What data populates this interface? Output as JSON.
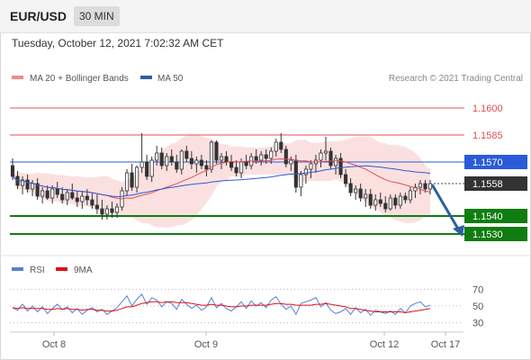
{
  "header": {
    "symbol": "EUR/USD",
    "timeframe": "30 MIN"
  },
  "datetime": "Tuesday, October 12, 2021 7:02:32 AM CET",
  "legend": {
    "ma20": {
      "label": "MA 20 + Bollinger Bands",
      "color": "#f08a8a"
    },
    "ma50": {
      "label": "MA 50",
      "color": "#2d5fa0"
    }
  },
  "credit": "Research © 2021 Trading Central",
  "rsi_legend": {
    "rsi": {
      "label": "RSI",
      "color": "#5b7fd6"
    },
    "ma9": {
      "label": "9MA",
      "color": "#e01010"
    }
  },
  "colors": {
    "resistance": "#e05050",
    "pivot": "#2a5bd7",
    "support": "#0f7d0f",
    "last": "#333333",
    "arrow": "#2d5fa0"
  },
  "chart_data": [
    {
      "type": "candlestick",
      "ylim": [
        1.1518,
        1.1612
      ],
      "x_ticks": [
        "Oct 8",
        "Oct 9",
        "Oct 12",
        "Oct 17"
      ],
      "levels": [
        {
          "value": 1.16,
          "label": "1.1600",
          "kind": "resistance"
        },
        {
          "value": 1.1585,
          "label": "1.1585",
          "kind": "resistance"
        },
        {
          "value": 1.157,
          "label": "1.1570",
          "kind": "pivot"
        },
        {
          "value": 1.154,
          "label": "1.1540",
          "kind": "support"
        },
        {
          "value": 1.153,
          "label": "1.1530",
          "kind": "support"
        }
      ],
      "last_price": {
        "value": 1.1558,
        "label": "1.1558"
      },
      "candles_ohlc": [
        [
          1.1568,
          1.1572,
          1.156,
          1.1562
        ],
        [
          1.1562,
          1.1565,
          1.1555,
          1.1557
        ],
        [
          1.1557,
          1.1562,
          1.1552,
          1.156
        ],
        [
          1.156,
          1.1563,
          1.1553,
          1.1555
        ],
        [
          1.1555,
          1.156,
          1.1551,
          1.1558
        ],
        [
          1.1558,
          1.1561,
          1.1549,
          1.1551
        ],
        [
          1.1551,
          1.1556,
          1.1547,
          1.1554
        ],
        [
          1.1554,
          1.1557,
          1.1549,
          1.155
        ],
        [
          1.155,
          1.1557,
          1.1547,
          1.1555
        ],
        [
          1.1555,
          1.1559,
          1.155,
          1.1552
        ],
        [
          1.1552,
          1.1556,
          1.1547,
          1.1549
        ],
        [
          1.1549,
          1.1555,
          1.1546,
          1.1553
        ],
        [
          1.1553,
          1.1558,
          1.1549,
          1.155
        ],
        [
          1.155,
          1.1554,
          1.1545,
          1.1548
        ],
        [
          1.1548,
          1.1554,
          1.1544,
          1.1551
        ],
        [
          1.1551,
          1.1555,
          1.1546,
          1.1549
        ],
        [
          1.1549,
          1.1553,
          1.1544,
          1.1546
        ],
        [
          1.1546,
          1.1552,
          1.1541,
          1.1544
        ],
        [
          1.1544,
          1.1549,
          1.1538,
          1.1541
        ],
        [
          1.1541,
          1.1546,
          1.1538,
          1.1544
        ],
        [
          1.1544,
          1.1548,
          1.1539,
          1.1542
        ],
        [
          1.1542,
          1.1547,
          1.1539,
          1.1545
        ],
        [
          1.1545,
          1.1556,
          1.1543,
          1.1554
        ],
        [
          1.1554,
          1.1566,
          1.1551,
          1.1564
        ],
        [
          1.1564,
          1.1569,
          1.1554,
          1.1556
        ],
        [
          1.1556,
          1.1568,
          1.1553,
          1.1567
        ],
        [
          1.1567,
          1.1586,
          1.1564,
          1.157
        ],
        [
          1.157,
          1.1574,
          1.156,
          1.1562
        ],
        [
          1.1562,
          1.1573,
          1.1559,
          1.1571
        ],
        [
          1.1571,
          1.1579,
          1.1568,
          1.1575
        ],
        [
          1.1575,
          1.1578,
          1.1566,
          1.1568
        ],
        [
          1.1568,
          1.1575,
          1.1565,
          1.1573
        ],
        [
          1.1573,
          1.1577,
          1.1568,
          1.157
        ],
        [
          1.157,
          1.1574,
          1.1564,
          1.1566
        ],
        [
          1.1566,
          1.1577,
          1.1563,
          1.1576
        ],
        [
          1.1576,
          1.1579,
          1.157,
          1.1572
        ],
        [
          1.1572,
          1.1576,
          1.1566,
          1.1569
        ],
        [
          1.1569,
          1.1573,
          1.1564,
          1.1571
        ],
        [
          1.1571,
          1.1574,
          1.1566,
          1.1568
        ],
        [
          1.1568,
          1.1571,
          1.1562,
          1.1566
        ],
        [
          1.1566,
          1.1582,
          1.1564,
          1.1581
        ],
        [
          1.1581,
          1.1582,
          1.1569,
          1.1571
        ],
        [
          1.1571,
          1.1575,
          1.1566,
          1.1573
        ],
        [
          1.1573,
          1.1576,
          1.1568,
          1.157
        ],
        [
          1.157,
          1.1574,
          1.1565,
          1.1567
        ],
        [
          1.1567,
          1.1571,
          1.1562,
          1.1564
        ],
        [
          1.1564,
          1.1572,
          1.1561,
          1.157
        ],
        [
          1.157,
          1.1574,
          1.1566,
          1.1568
        ],
        [
          1.1568,
          1.1575,
          1.1566,
          1.1573
        ],
        [
          1.1573,
          1.1577,
          1.1569,
          1.1571
        ],
        [
          1.1571,
          1.1576,
          1.1568,
          1.1574
        ],
        [
          1.1574,
          1.1577,
          1.1569,
          1.1572
        ],
        [
          1.1572,
          1.1578,
          1.1569,
          1.1576
        ],
        [
          1.1576,
          1.1583,
          1.1573,
          1.1581
        ],
        [
          1.1581,
          1.1586,
          1.1575,
          1.1577
        ],
        [
          1.1577,
          1.1579,
          1.1567,
          1.1569
        ],
        [
          1.1569,
          1.1573,
          1.1565,
          1.1571
        ],
        [
          1.1571,
          1.1574,
          1.1553,
          1.1556
        ],
        [
          1.1556,
          1.1565,
          1.1551,
          1.1563
        ],
        [
          1.1563,
          1.1568,
          1.1558,
          1.1566
        ],
        [
          1.1566,
          1.1571,
          1.1561,
          1.1569
        ],
        [
          1.1569,
          1.1574,
          1.1564,
          1.1571
        ],
        [
          1.1571,
          1.1577,
          1.1567,
          1.1575
        ],
        [
          1.1575,
          1.1584,
          1.1571,
          1.1576
        ],
        [
          1.1576,
          1.1578,
          1.1566,
          1.1568
        ],
        [
          1.1568,
          1.1574,
          1.1563,
          1.1572
        ],
        [
          1.1572,
          1.1575,
          1.1561,
          1.1563
        ],
        [
          1.1563,
          1.1566,
          1.1556,
          1.1558
        ],
        [
          1.1558,
          1.1561,
          1.1551,
          1.1553
        ],
        [
          1.1553,
          1.1557,
          1.1549,
          1.1555
        ],
        [
          1.1555,
          1.1558,
          1.1548,
          1.155
        ],
        [
          1.155,
          1.1555,
          1.1545,
          1.1552
        ],
        [
          1.1552,
          1.1555,
          1.1544,
          1.1546
        ],
        [
          1.1546,
          1.1552,
          1.1543,
          1.1549
        ],
        [
          1.1549,
          1.1553,
          1.1545,
          1.1547
        ],
        [
          1.1547,
          1.1551,
          1.1542,
          1.1544
        ],
        [
          1.1544,
          1.1552,
          1.1543,
          1.155
        ],
        [
          1.155,
          1.1552,
          1.1544,
          1.1546
        ],
        [
          1.1546,
          1.1553,
          1.1544,
          1.1551
        ],
        [
          1.1551,
          1.1553,
          1.1547,
          1.1549
        ],
        [
          1.1549,
          1.1556,
          1.1547,
          1.1554
        ],
        [
          1.1554,
          1.1558,
          1.155,
          1.1556
        ],
        [
          1.1556,
          1.156,
          1.1552,
          1.1558
        ],
        [
          1.1558,
          1.156,
          1.1553,
          1.1555
        ],
        [
          1.1555,
          1.156,
          1.1552,
          1.1558
        ]
      ]
    },
    {
      "type": "line",
      "name": "RSI",
      "ylim": [
        20,
        80
      ],
      "y_ticks": [
        70,
        50,
        30
      ],
      "series": [
        {
          "name": "RSI",
          "values": [
            48,
            45,
            52,
            44,
            50,
            43,
            49,
            41,
            47,
            52,
            46,
            49,
            42,
            47,
            40,
            45,
            48,
            43,
            46,
            40,
            44,
            48,
            55,
            62,
            50,
            58,
            64,
            52,
            60,
            57,
            49,
            55,
            53,
            46,
            58,
            52,
            47,
            51,
            45,
            49,
            60,
            48,
            53,
            47,
            44,
            49,
            55,
            47,
            56,
            50,
            54,
            48,
            57,
            61,
            52,
            46,
            50,
            40,
            53,
            55,
            57,
            60,
            49,
            54,
            45,
            41,
            43,
            47,
            40,
            48,
            42,
            46,
            39,
            45,
            43,
            41,
            44,
            40,
            47,
            42,
            50,
            53,
            55,
            49,
            51
          ]
        },
        {
          "name": "9MA",
          "values": [
            48,
            47,
            48,
            47,
            47,
            47,
            47,
            46,
            46,
            47,
            46,
            47,
            46,
            46,
            45,
            46,
            46,
            45,
            45,
            44,
            44,
            45,
            47,
            49,
            49,
            51,
            53,
            54,
            55,
            55,
            54,
            55,
            55,
            54,
            54,
            54,
            53,
            52,
            51,
            51,
            52,
            51,
            51,
            50,
            49,
            49,
            50,
            50,
            51,
            51,
            51,
            51,
            52,
            53,
            53,
            52,
            52,
            51,
            51,
            51,
            51,
            52,
            52,
            53,
            52,
            51,
            50,
            49,
            47,
            47,
            46,
            45,
            44,
            43,
            43,
            43,
            43,
            43,
            43,
            42,
            43,
            44,
            45,
            46,
            47
          ]
        }
      ]
    }
  ]
}
